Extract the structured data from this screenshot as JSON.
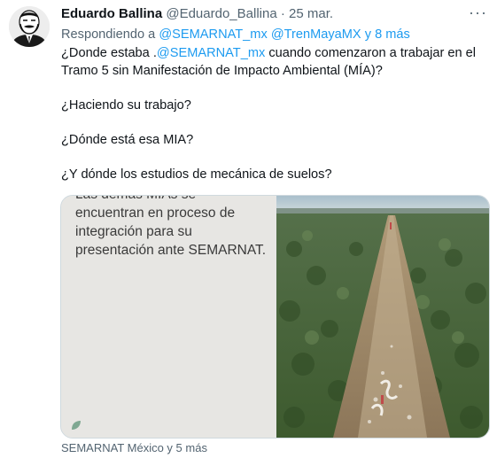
{
  "tweet": {
    "author_name": "Eduardo Ballina",
    "author_handle": "@Eduardo_Ballina",
    "separator": "·",
    "date": "25 mar.",
    "more_icon": "more-horizontal-icon",
    "reply_prefix": "Respondiendo a ",
    "reply_mention_1": "@SEMARNAT_mx",
    "reply_mention_2": "@TrenMayaMX",
    "reply_and": " y ",
    "reply_more": "8 más",
    "body_line1_pre": "¿Donde estaba .",
    "body_line1_link": "@SEMARNAT_mx",
    "body_line1_post": " cuando comenzaron a trabajar en el Tramo 5 sin Manifestación de Impacto Ambiental (MÍA)?",
    "body_line2": "¿Haciendo su trabajo?",
    "body_line3": "¿Dónde está esa MIA?",
    "body_line4": "¿Y dónde los estudios de mecánica de suelos?",
    "image_left_text": [
      "Las demás MIAs se",
      "encuentran en proceso de",
      "integración para su",
      "presentación ante SEMARNAT."
    ],
    "image_right_alt": "aerial-jungle-clearing-photo",
    "media_tags": "SEMARNAT México y 5 más"
  }
}
